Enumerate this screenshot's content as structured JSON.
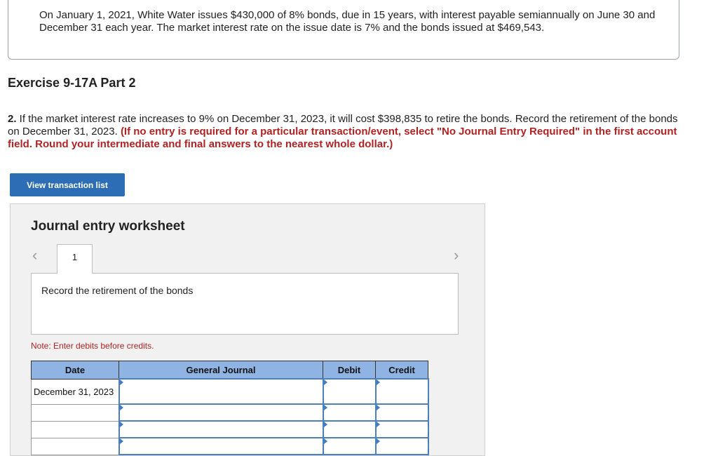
{
  "problem": {
    "text": "On January 1, 2021, White Water issues $430,000 of 8% bonds, due in 15 years, with interest payable semiannually on June 30 and December 31 each year. The market interest rate on the issue date is 7% and the bonds issued at $469,543."
  },
  "exercise": {
    "title": "Exercise 9-17A Part 2"
  },
  "question": {
    "number": "2.",
    "text": " If the market interest rate increases to 9% on December 31, 2023, it will cost $398,835 to retire the bonds. Record the retirement of the bonds on December 31, 2023. ",
    "instruction": "(If no entry is required for a particular transaction/event, select \"No Journal Entry Required\" in the first account field. Round your intermediate and final answers to the nearest whole dollar.)"
  },
  "buttons": {
    "view_transactions": "View transaction list"
  },
  "worksheet": {
    "title": "Journal entry worksheet",
    "prev_icon": "chevron-left-icon",
    "next_icon": "chevron-right-icon",
    "tab_label": "1",
    "description": "Record the retirement of the bonds",
    "note": "Note: Enter debits before credits.",
    "columns": [
      "Date",
      "General Journal",
      "Debit",
      "Credit"
    ],
    "rows": [
      {
        "date": "December 31, 2023",
        "account": "",
        "debit": "",
        "credit": ""
      },
      {
        "date": "",
        "account": "",
        "debit": "",
        "credit": ""
      },
      {
        "date": "",
        "account": "",
        "debit": "",
        "credit": ""
      },
      {
        "date": "",
        "account": "",
        "debit": "",
        "credit": ""
      }
    ]
  },
  "colors": {
    "button": "#2d6db5",
    "header": "#8fb3e3",
    "instruction": "#b22222"
  }
}
